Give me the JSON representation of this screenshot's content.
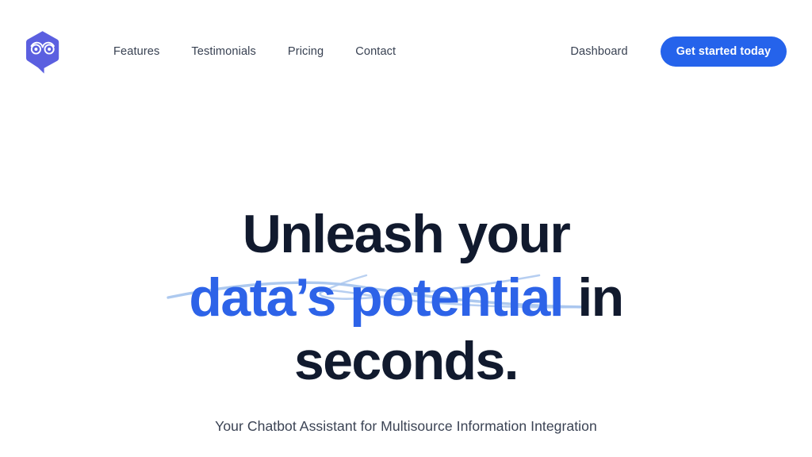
{
  "brand": {
    "logo_icon": "owl-logo-icon",
    "logo_color": "#5b5fe0",
    "logo_alt": "Owl chatbot logo"
  },
  "header": {
    "nav_items": [
      {
        "label": "Features"
      },
      {
        "label": "Testimonials"
      },
      {
        "label": "Pricing"
      },
      {
        "label": "Contact"
      }
    ],
    "dashboard_label": "Dashboard",
    "cta_label": "Get started today",
    "cta_color": "#2563eb",
    "nav_text_color": "#384152"
  },
  "hero": {
    "headline_line1": "Unleash your",
    "headline_line2_accent": "data’s potential",
    "headline_line2_rest": " in",
    "headline_line3": "seconds.",
    "headline_color": "#111a2e",
    "accent_color": "#2d63e8",
    "underline_color": "#a9c6ee",
    "underline_icon": "hand-drawn-swoosh-underline",
    "subtitle": "Your Chatbot Assistant for Multisource Information Integration",
    "subtitle_color": "#3b4354"
  }
}
